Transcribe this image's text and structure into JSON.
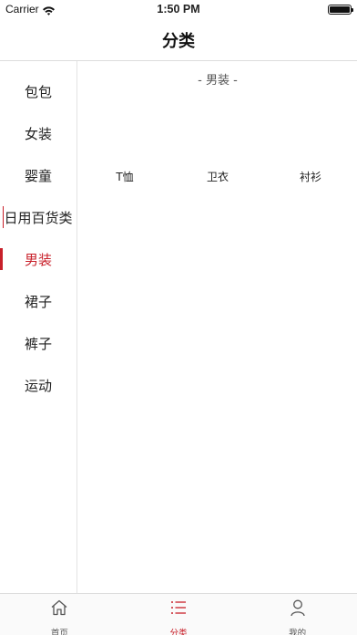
{
  "status_bar": {
    "carrier": "Carrier",
    "time": "1:50 PM"
  },
  "nav": {
    "title": "分类"
  },
  "sidebar": {
    "items": [
      {
        "label": "包包"
      },
      {
        "label": "女装"
      },
      {
        "label": "婴童"
      },
      {
        "label": "日用百货类"
      },
      {
        "label": "男装"
      },
      {
        "label": "裙子"
      },
      {
        "label": "裤子"
      },
      {
        "label": "运动"
      }
    ],
    "selected": "男装"
  },
  "content": {
    "section_title": "- 男装 -",
    "subcategories": [
      "T恤",
      "卫衣",
      "衬衫"
    ]
  },
  "tab_bar": {
    "tabs": [
      {
        "label": "首页",
        "icon": "home-icon"
      },
      {
        "label": "分类",
        "icon": "list-icon"
      },
      {
        "label": "我的",
        "icon": "user-icon"
      }
    ]
  },
  "colors": {
    "accent": "#c8202a",
    "divider": "#dddddd"
  }
}
